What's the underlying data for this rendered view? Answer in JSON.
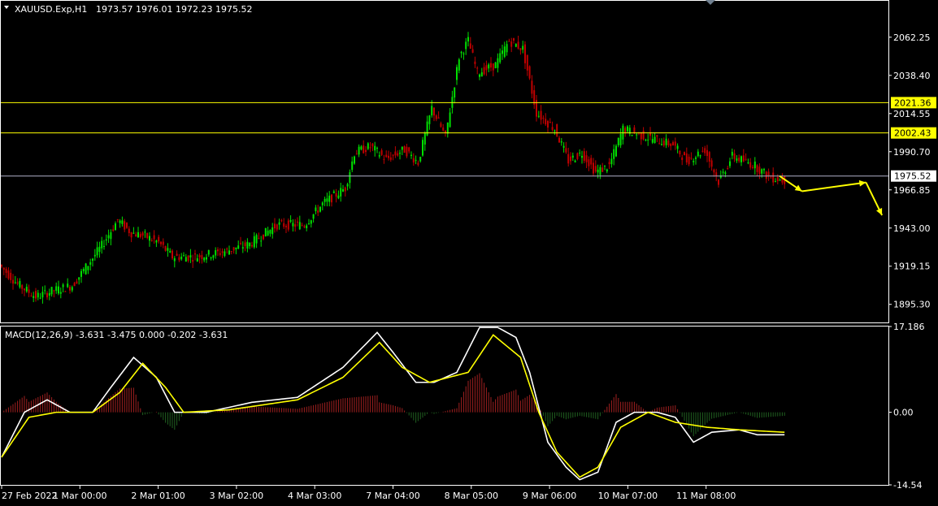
{
  "header": {
    "symbol": "XAUUSD.Exp,H1",
    "ohlc": "1973.57 1976.01 1972.23 1975.52"
  },
  "macd_header": "MACD(12,26,9) -3.631 -3.475 0.000 -0.202 -3.631",
  "colors": {
    "background": "#000000",
    "bull": "#00e000",
    "bear": "#c00000",
    "level_line": "#ffff00",
    "price_line": "#b0b0c8",
    "arrow": "#ffff00",
    "macd_main": "#ffffff",
    "macd_signal": "#ffff00",
    "hist_pos": "#a02020",
    "hist_neg": "#206020"
  },
  "chart_data": [
    {
      "type": "candlestick",
      "title": "XAUUSD.Exp,H1",
      "ylim": [
        1884,
        2085
      ],
      "y_ticks": [
        2062.25,
        2038.4,
        2014.55,
        1990.7,
        1966.85,
        1943.0,
        1919.15,
        1895.3
      ],
      "y_tick_labels": [
        "2062.25",
        "2038.40",
        "2014.55",
        "1990.70",
        "1966.85",
        "1943.00",
        "1919.15",
        "1895.30"
      ],
      "horizontal_levels": [
        {
          "value": 2021.36,
          "label": "2021.36",
          "style": "level"
        },
        {
          "value": 2002.43,
          "label": "2002.43",
          "style": "level"
        },
        {
          "value": 1975.52,
          "label": "1975.52",
          "style": "current"
        }
      ],
      "x_labels": [
        "27 Feb 2022",
        "1 Mar 00:00",
        "2 Mar 01:00",
        "3 Mar 02:00",
        "4 Mar 03:00",
        "7 Mar 04:00",
        "8 Mar 05:00",
        "9 Mar 06:00",
        "10 Mar 07:00",
        "11 Mar 08:00"
      ],
      "path_anchors": [
        [
          0,
          1920
        ],
        [
          8,
          1908
        ],
        [
          16,
          1900
        ],
        [
          24,
          1904
        ],
        [
          32,
          1907
        ],
        [
          45,
          1932
        ],
        [
          52,
          1948
        ],
        [
          58,
          1940
        ],
        [
          64,
          1938
        ],
        [
          70,
          1934
        ],
        [
          76,
          1925
        ],
        [
          86,
          1925
        ],
        [
          98,
          1928
        ],
        [
          110,
          1933
        ],
        [
          122,
          1945
        ],
        [
          134,
          1945
        ],
        [
          142,
          1958
        ],
        [
          152,
          1968
        ],
        [
          156,
          1990
        ],
        [
          163,
          1994
        ],
        [
          170,
          1986
        ],
        [
          178,
          1992
        ],
        [
          184,
          1984
        ],
        [
          190,
          2018
        ],
        [
          196,
          2000
        ],
        [
          202,
          2050
        ],
        [
          206,
          2060
        ],
        [
          210,
          2040
        ],
        [
          218,
          2045
        ],
        [
          224,
          2060
        ],
        [
          230,
          2055
        ],
        [
          236,
          2015
        ],
        [
          244,
          2005
        ],
        [
          250,
          1985
        ],
        [
          256,
          1990
        ],
        [
          262,
          1978
        ],
        [
          268,
          1982
        ],
        [
          274,
          2005
        ],
        [
          284,
          2000
        ],
        [
          296,
          1995
        ],
        [
          302,
          1985
        ],
        [
          310,
          1992
        ],
        [
          316,
          1972
        ],
        [
          322,
          1988
        ],
        [
          332,
          1982
        ],
        [
          338,
          1975
        ],
        [
          344,
          1973
        ]
      ],
      "forecast_arrow": [
        [
          1966,
          1975.5
        ],
        [
          1973,
          1966
        ],
        [
          1993,
          1971.5
        ],
        [
          1998,
          1951
        ]
      ]
    },
    {
      "type": "macd",
      "title": "MACD(12,26,9)",
      "ylim": [
        -14.54,
        17.186
      ],
      "y_tick_labels": [
        "17.186",
        "0.00",
        "-14.54"
      ],
      "series": [
        {
          "name": "main",
          "anchors": [
            [
              0,
              -9
            ],
            [
              10,
              0
            ],
            [
              20,
              2.5
            ],
            [
              30,
              0
            ],
            [
              40,
              0
            ],
            [
              48,
              5
            ],
            [
              58,
              11
            ],
            [
              68,
              7
            ],
            [
              76,
              0
            ],
            [
              90,
              0
            ],
            [
              110,
              2
            ],
            [
              130,
              3
            ],
            [
              150,
              9
            ],
            [
              165,
              16
            ],
            [
              172,
              12
            ],
            [
              182,
              6
            ],
            [
              190,
              6
            ],
            [
              200,
              8
            ],
            [
              210,
              17
            ],
            [
              218,
              17
            ],
            [
              226,
              15
            ],
            [
              232,
              8
            ],
            [
              240,
              -6
            ],
            [
              248,
              -11
            ],
            [
              254,
              -13.5
            ],
            [
              262,
              -12
            ],
            [
              270,
              -2
            ],
            [
              278,
              0
            ],
            [
              288,
              0
            ],
            [
              296,
              -1
            ],
            [
              304,
              -6
            ],
            [
              312,
              -4
            ],
            [
              324,
              -3.5
            ],
            [
              332,
              -4.5
            ],
            [
              344,
              -4.5
            ]
          ]
        },
        {
          "name": "signal",
          "anchors": [
            [
              0,
              -9
            ],
            [
              12,
              -1
            ],
            [
              24,
              0
            ],
            [
              40,
              0
            ],
            [
              52,
              4
            ],
            [
              62,
              9.8
            ],
            [
              72,
              5
            ],
            [
              80,
              0
            ],
            [
              100,
              0.5
            ],
            [
              130,
              2.5
            ],
            [
              150,
              7
            ],
            [
              166,
              14
            ],
            [
              176,
              9
            ],
            [
              188,
              6
            ],
            [
              205,
              8
            ],
            [
              216,
              15.5
            ],
            [
              228,
              11
            ],
            [
              236,
              0
            ],
            [
              244,
              -8
            ],
            [
              254,
              -13
            ],
            [
              262,
              -11
            ],
            [
              272,
              -3
            ],
            [
              284,
              0
            ],
            [
              296,
              -2
            ],
            [
              310,
              -3
            ],
            [
              324,
              -3.5
            ],
            [
              344,
              -4
            ]
          ]
        }
      ]
    }
  ]
}
